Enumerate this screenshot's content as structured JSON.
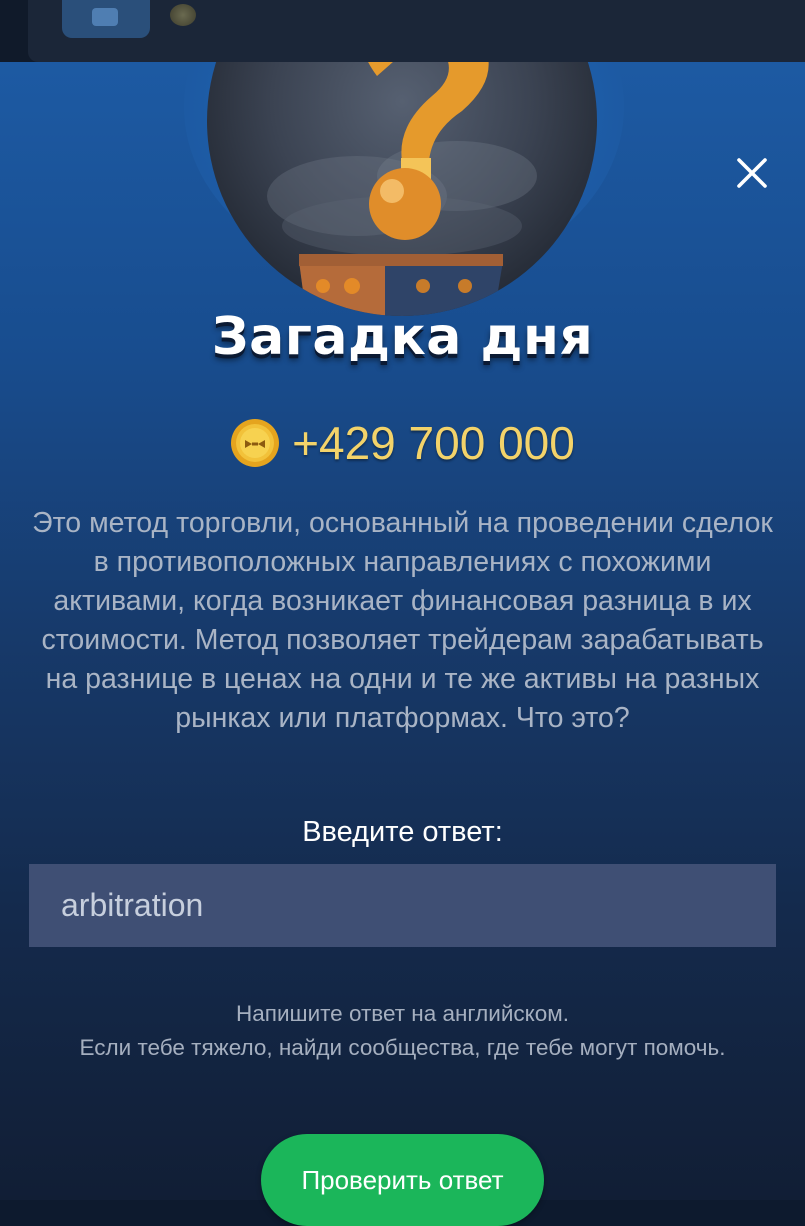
{
  "modal": {
    "title": "Загадка дня",
    "reward": "+429 700 000",
    "question": "Это метод торговли, основанный на проведении сделок в противоположных направлениях с похожими активами, когда возникает финансовая разница в их стоимости. Метод позволяет трейдерам зарабатывать на разнице в ценах на одни и те же активы на разных рынках или платформах. Что это?",
    "answer_label": "Введите ответ:",
    "answer_value": "arbitration",
    "hint_line_1": "Напишите ответ на английском.",
    "hint_line_2": "Если тебе тяжело, найди сообщества, где тебе могут помочь.",
    "submit_label": "Проверить ответ",
    "icons": {
      "close": "close-icon",
      "coin": "coin-icon",
      "hero": "question-mark-illustration"
    }
  },
  "colors": {
    "accent_green": "#1bb65a",
    "reward_gold": "#f3d36a",
    "sheet_blue": "#1d5aa3"
  }
}
